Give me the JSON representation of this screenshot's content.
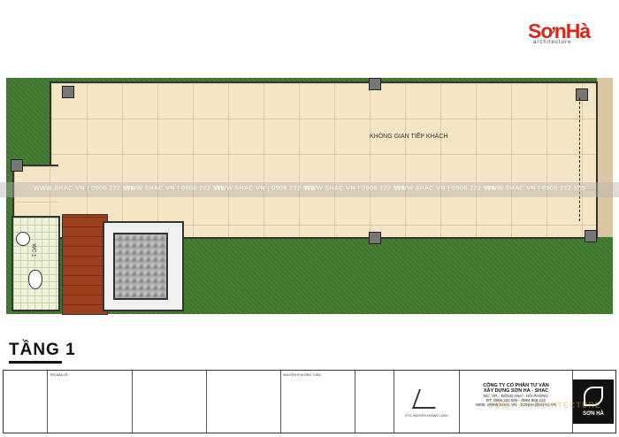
{
  "logo": {
    "text": "SơnHà",
    "subtitle": "architecture"
  },
  "plan": {
    "room_label": "KHÔNG GIAN TIẾP KHÁCH",
    "wc_label": "WC 1",
    "watermark": "WWW.SHAC.VN  |  0906.222.555",
    "floor_title": "TẦNG 1"
  },
  "title_block": {
    "company_line1": "CÔNG TY CỔ PHẦN TƯ VẤN",
    "company_line2": "XÂY DỰNG SƠN HÀ - SHAC",
    "address": "ĐC: VP... ĐÔNG ANH - HẢI PHÒNG",
    "phone": "ĐT: 0906.222.555 - 0984.666.222",
    "web": "WEB: WWW.SHAC.VN - SONHA@SHAC.VN",
    "brand": "SƠN HÀ",
    "architect": "KTS. NGUYỄN HOÀNG LONG",
    "designer": "NGUYỄN PHƯƠNG TUẤN",
    "drawing_name": "TÊN BẢN VẼ :",
    "watermark": "SƠN HÀ ARCHITECTURE"
  }
}
